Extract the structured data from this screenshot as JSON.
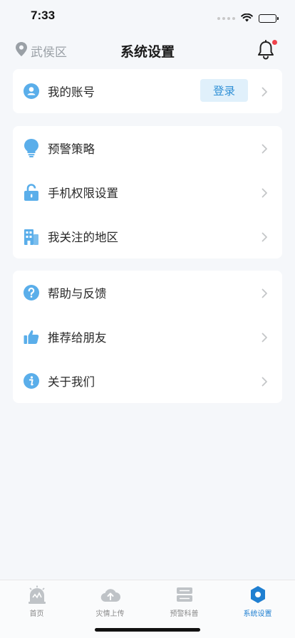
{
  "status": {
    "time": "7:33"
  },
  "header": {
    "location": "武侯区",
    "title": "系统设置",
    "has_notification": true
  },
  "colors": {
    "accent": "#2e8fd6",
    "icon": "#5aaeea",
    "notification": "#f0434c",
    "active_tab": "#1f7fd1"
  },
  "account_card": {
    "label": "我的账号",
    "login_label": "登录",
    "icon": "user-icon"
  },
  "settings_card": {
    "items": [
      {
        "label": "预警策略",
        "icon": "lightbulb-icon"
      },
      {
        "label": "手机权限设置",
        "icon": "lock-icon"
      },
      {
        "label": "我关注的地区",
        "icon": "building-icon"
      }
    ]
  },
  "help_card": {
    "items": [
      {
        "label": "帮助与反馈",
        "icon": "question-icon"
      },
      {
        "label": "推荐给朋友",
        "icon": "thumbs-up-icon"
      },
      {
        "label": "关于我们",
        "icon": "info-icon"
      }
    ]
  },
  "tabbar": {
    "tabs": [
      {
        "label": "首页",
        "icon": "home-alert-icon",
        "active": false
      },
      {
        "label": "灾情上传",
        "icon": "cloud-upload-icon",
        "active": false
      },
      {
        "label": "预警科普",
        "icon": "book-stack-icon",
        "active": false
      },
      {
        "label": "系统设置",
        "icon": "settings-hexagon-icon",
        "active": true
      }
    ]
  }
}
